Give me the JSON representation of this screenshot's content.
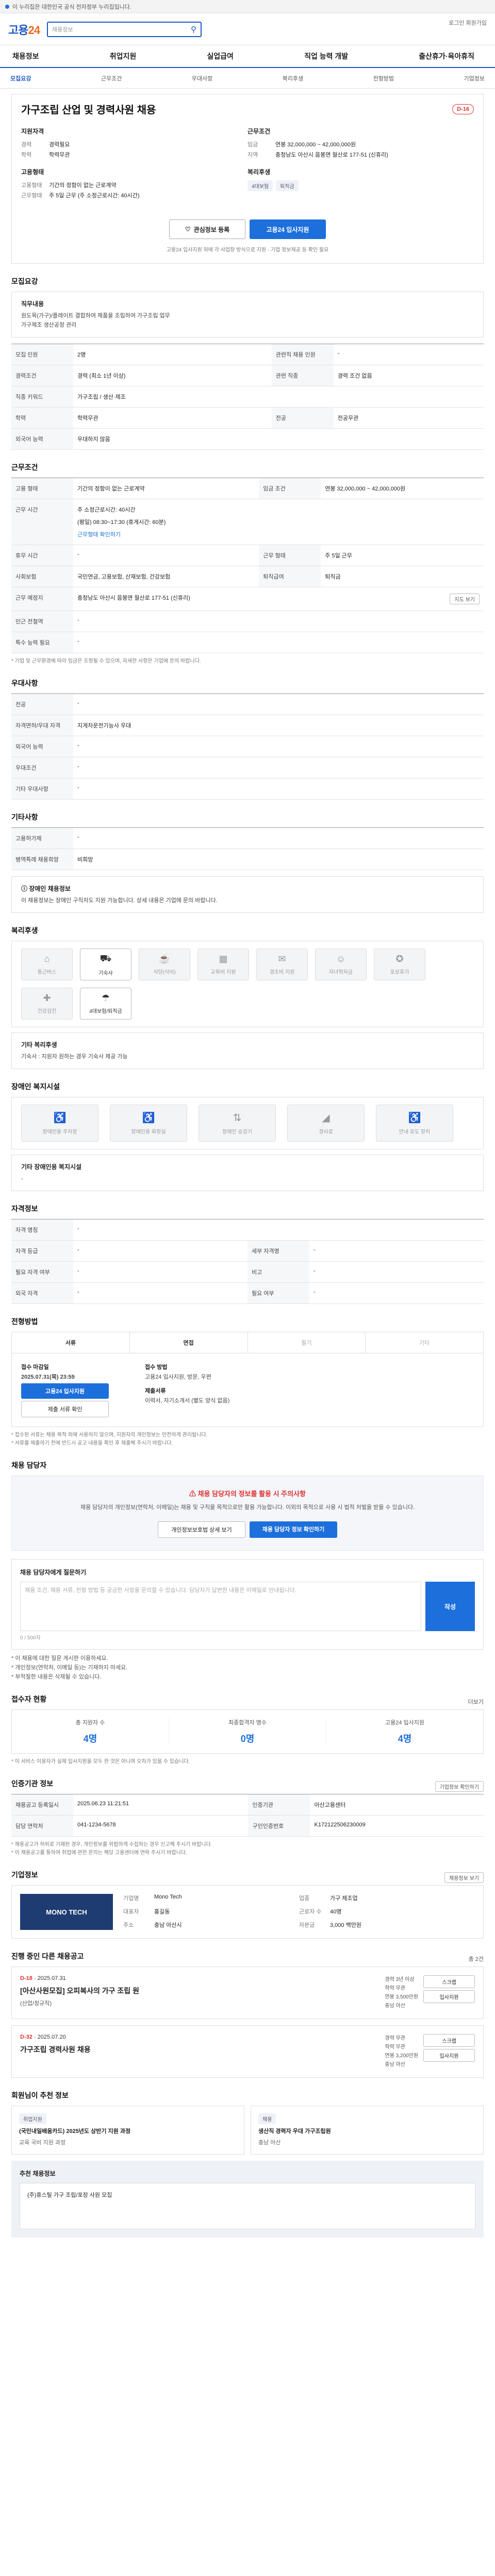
{
  "topbar": {
    "text": "이 누리집은 대한민국 공식 전자정부 누리집입니다."
  },
  "header": {
    "logo_main": "고용",
    "logo_sub": "24",
    "search_placeholder": "채용정보",
    "links": "로그인 회원가입"
  },
  "nav": [
    "채용정보",
    "취업지원",
    "실업급여",
    "직업 능력 개발",
    "출산휴가·육아휴직"
  ],
  "subnav": [
    {
      "label": "모집요강",
      "on": true
    },
    {
      "label": "근무조건",
      "on": false
    },
    {
      "label": "우대사항",
      "on": false
    },
    {
      "label": "복리후생",
      "on": false
    },
    {
      "label": "전형방법",
      "on": false
    },
    {
      "label": "기업정보",
      "on": false
    }
  ],
  "job": {
    "title": "가구조립 산업 및 경력사원 채용",
    "dday": "D-16",
    "left_title": "지원자격",
    "left": [
      {
        "k": "경력",
        "v": "경력필요"
      },
      {
        "k": "학력",
        "v": "학력무관"
      }
    ],
    "right_title": "근무조건",
    "right": [
      {
        "k": "임금",
        "v": "연봉 32,000,000 ~ 42,000,000원"
      },
      {
        "k": "지역",
        "v": "충청남도 아산시 음봉면 월산로 177-51 (신휴리)"
      }
    ],
    "left2_title": "고용형태",
    "left2": [
      {
        "k": "고용형태",
        "v": "기간의 정함이 없는 근로계약"
      },
      {
        "k": "근무형태",
        "v": "주 5일 근무 (주 소정근로시간: 40시간)"
      }
    ],
    "right2_title": "복리후생",
    "chips": [
      "4대보험",
      "퇴직금"
    ],
    "btn_like": "관심정보 등록",
    "btn_apply": "고용24 입사지원",
    "notes": "고용24 입사지원 외에 각 사업장 방식으로 지원 · 기업 정보제공 등 확인 필요"
  },
  "recruit": {
    "section": "모집요강",
    "duty_t": "직무내용",
    "duty": "원도목(가구)/플레이트 결합하여 제품을 조립하여 가구조립 업무",
    "duty2": "가구제조 생산공정 관리",
    "rows": [
      {
        "k": "모집 인원",
        "v": "2명",
        "k2": "관련직 채용 인원",
        "v2": "-"
      },
      {
        "k": "경력조건",
        "v": "경력 (최소 1년 이상)",
        "k2": "관련 직종",
        "v2": "경력 조건 없음"
      },
      {
        "k": "직종 키워드",
        "v": "가구조립 / 생산·제조"
      },
      {
        "k": "학력",
        "v": "학력무관",
        "k2": "전공",
        "v2": "전공무관"
      },
      {
        "k": "외국어 능력",
        "v": "우대하지 않음"
      }
    ]
  },
  "work": {
    "section": "근무조건",
    "rows": [
      {
        "k": "고용 형태",
        "v": "기간의 정함이 없는 근로계약",
        "k2": "임금 조건",
        "v2": "연봉 32,000,000 ~ 42,000,000원"
      },
      {
        "k": "근무 시간",
        "v": "주 소정근로시간: 40시간",
        "v_sub": "(평일) 08:30~17:30 (휴게시간: 60분)",
        "v_link": "근무형태 확인하기"
      },
      {
        "k": "휴무 시간",
        "v": "-",
        "k2": "근무 형태",
        "v2": "주 5일 근무"
      },
      {
        "k": "사회보험",
        "v": "국민연금, 고용보험, 산재보험, 건강보험",
        "k2": "퇴직급여",
        "v2": "퇴직금"
      },
      {
        "k": "근무 예정지",
        "v": "충청남도 아산시 음봉면 월산로 177-51 (신휴리)",
        "btn": "지도 보기"
      },
      {
        "k": "인근 전철역",
        "v": "-"
      },
      {
        "k": "특수 능력 필요",
        "v": "-"
      }
    ],
    "footnote": "* 기업 및 근무환경에 따라 임금은 조정될 수 있으며, 자세한 사항은 기업에 문의 바랍니다."
  },
  "prefer": {
    "section": "우대사항",
    "rows": [
      {
        "k": "전공",
        "v": "-"
      },
      {
        "k": "자격면허/우대 자격",
        "v": "지게차운전기능사 우대"
      },
      {
        "k": "외국어 능력",
        "v": "-"
      },
      {
        "k": "우대조건",
        "v": "-"
      },
      {
        "k": "기타 우대사항",
        "v": "-"
      }
    ]
  },
  "other": {
    "section": "기타사항",
    "rows": [
      {
        "k": "고용허가제",
        "v": "-"
      },
      {
        "k": "병역특례 채용희망",
        "v": "비희망"
      }
    ],
    "box_t": "장애인 채용정보",
    "box_p": "이 채용정보는 장애인 구직자도 지원 가능합니다. 상세 내용은 기업에 문의 바랍니다."
  },
  "welfare": {
    "section": "복리후생",
    "icons": [
      {
        "icon": "house-icon",
        "label": "통근버스",
        "on": false
      },
      {
        "icon": "car-icon",
        "label": "기숙사",
        "on": true
      },
      {
        "icon": "meal-icon",
        "label": "식당(식비)",
        "on": false
      },
      {
        "icon": "building-icon",
        "label": "교육비 지원",
        "on": false
      },
      {
        "icon": "gift-icon",
        "label": "경조비 지원",
        "on": false
      },
      {
        "icon": "baby-icon",
        "label": "자녀학자금",
        "on": false
      },
      {
        "icon": "medal-icon",
        "label": "포상휴가",
        "on": false
      },
      {
        "icon": "health-icon",
        "label": "건강검진",
        "on": false
      },
      {
        "icon": "insurance-icon",
        "label": "4대보험/퇴직금",
        "on": true
      }
    ],
    "box_t": "기타 복리후생",
    "box_p": "기숙사 : 지원자 원하는 경우 기숙사 제공 가능"
  },
  "disability": {
    "section": "장애인 복지시설",
    "icons": [
      {
        "icon": "ramp-icon",
        "label": "장애인용 주차장"
      },
      {
        "icon": "toilet-icon",
        "label": "장애인용 화장실"
      },
      {
        "icon": "elevator-icon",
        "label": "장애인 승강기"
      },
      {
        "icon": "slope-icon",
        "label": "경사로"
      },
      {
        "icon": "wheel-icon",
        "label": "안내 유도 장치"
      }
    ],
    "box_t": "기타 장애인용 복지시설",
    "box_p": "-"
  },
  "qualify": {
    "section": "자격정보",
    "rows": [
      {
        "k": "자격 명칭",
        "v": "-",
        "k2": "",
        "v2": ""
      },
      {
        "k": "자격 등급",
        "v": "-",
        "k2": "세부 자격명",
        "v2": "-"
      },
      {
        "k": "필요 자격 여부",
        "v": "-",
        "k2": "비고",
        "v2": "-"
      },
      {
        "k": "외국 자격",
        "v": "-",
        "k2": "필요 여부",
        "v2": "-"
      }
    ]
  },
  "screen": {
    "section": "전형방법",
    "tabs": [
      {
        "label": "서류",
        "on": true
      },
      {
        "label": "면접",
        "on": true
      },
      {
        "label": "필기",
        "on": false
      },
      {
        "label": "기타",
        "on": false
      }
    ],
    "apply_deadline_k": "접수 마감일",
    "apply_deadline_v": "2025.07.31(목) 23:59",
    "apply_method_k": "접수 방법",
    "apply_method_v": "고용24 입사지원, 방문, 우편",
    "apply_btn": "고용24 입사지원",
    "docs_k": "제출서류",
    "docs_v": "이력서, 자기소개서 (별도 양식 없음)",
    "docs_btn": "제출 서류 확인",
    "notes": [
      "* 접수된 서류는 채용 목적 외에 사용하지 않으며, 지원자의 개인정보는 안전하게 관리됩니다.",
      "* 서류를 제출하기 전에 반드시 공고 내용을 확인 후 제출해 주시기 바랍니다."
    ]
  },
  "contact": {
    "section": "채용 담당자",
    "warn_t": "채용 담당자의 정보를 활용 시 주의사항",
    "warn_p": "채용 담당자의 개인정보(연락처, 이메일)는 채용 및 구직을 목적으로만 활용 가능합니다. 이외의 목적으로 사용 시 법적 처벌을 받을 수 있습니다.",
    "btn1": "개인정보보호법 상세 보기",
    "btn2": "채용 담당자 정보 확인하기",
    "q_t": "채용 담당자에게 질문하기",
    "q_placeholder": "채용 조건, 채용 서류, 전형 방법 등 궁금한 사항을 문의할 수 있습니다. 담당자가 답변한 내용은 이메일로 안내됩니다.",
    "q_count": "0 / 500자",
    "q_btn": "작성",
    "q_notes": [
      "* 이 채용에 대한 질문 게시판 이용하세요.",
      "* 개인정보(연락처, 이메일 등)는 기재하지 마세요.",
      "* 부적절한 내용은 삭제될 수 있습니다."
    ]
  },
  "status": {
    "section": "접수자 현황",
    "more": "더보기",
    "stats": [
      {
        "l": "총 지원자 수",
        "n": "4명"
      },
      {
        "l": "최종합격자 명수",
        "n": "0명"
      },
      {
        "l": "고용24 입사지원",
        "n": "4명"
      }
    ],
    "note": "* 이 서비스 이용자가 실제 입사지원을 모두 한 것은 아니며 오차가 있을 수 있습니다."
  },
  "mgmt": {
    "section": "인증기관 정보",
    "btn": "기업정보 확인하기",
    "rows": [
      {
        "k": "채용공고 등록일시",
        "v": "2025.06.23 11:21:51",
        "k2": "인증기관",
        "v2": "아산고용센터"
      },
      {
        "k": "담당 연락처",
        "v": "041-1234-5678",
        "k2": "구인인증번호",
        "v2": "K172122506230009"
      }
    ],
    "notes": [
      "* 채용공고가 허위로 기재된 경우, 개인정보를 위법하게 수집하는 경우 신고해 주시기 바랍니다.",
      "* 이 채용공고를 통하여 취업에 관한 문의는 해당 고용센터에 연락 주시기 바랍니다."
    ]
  },
  "company": {
    "section": "기업정보",
    "btn": "채용정보 보기",
    "logo": "MONO TECH",
    "rows": [
      {
        "k": "기업명",
        "v": "Mono Tech",
        "k2": "업종",
        "v2": "가구 제조업"
      },
      {
        "k": "대표자",
        "v": "홍길동",
        "k2": "근로자 수",
        "v2": "40명"
      },
      {
        "k": "주소",
        "v": "충남 아산시",
        "k2": "자본금",
        "v2": "3,000 백만원"
      }
    ]
  },
  "others": {
    "section": "진행 중인 다른 채용공고",
    "more": "총 2건",
    "jobs": [
      {
        "dday": "D-18",
        "date": "2025.07.31",
        "title": "[아산사원모집] 오피복사의 가구 조립 원",
        "sub": "(산업/정규직)",
        "info": [
          "경력 3년 이상",
          "학력 무관",
          "연봉 3,500만원",
          "충남 아산"
        ],
        "btns": [
          "스크랩",
          "입사지원"
        ]
      },
      {
        "dday": "D-32",
        "date": "2025.07.20",
        "title": "가구조립 경력사원 채용",
        "sub": "",
        "info": [
          "경력 무관",
          "학력 무관",
          "연봉 3,200만원",
          "충남 아산"
        ],
        "btns": [
          "스크랩",
          "입사지원"
        ]
      }
    ]
  },
  "recommend": {
    "section": "회원님이 추천 정보",
    "cards": [
      {
        "tag": "취업지원",
        "t": "(국민내일배움카드) 2025년도 상반기 지원 과정",
        "m": "교육 국비 지원 과정"
      },
      {
        "tag": "채용",
        "t": "생산직 경력자 우대 가구조립원",
        "m": "충남 아산"
      }
    ],
    "sub_t": "추천 채용정보",
    "item": "(주)휴스틸 가구 조립/포장 사원 모집"
  }
}
